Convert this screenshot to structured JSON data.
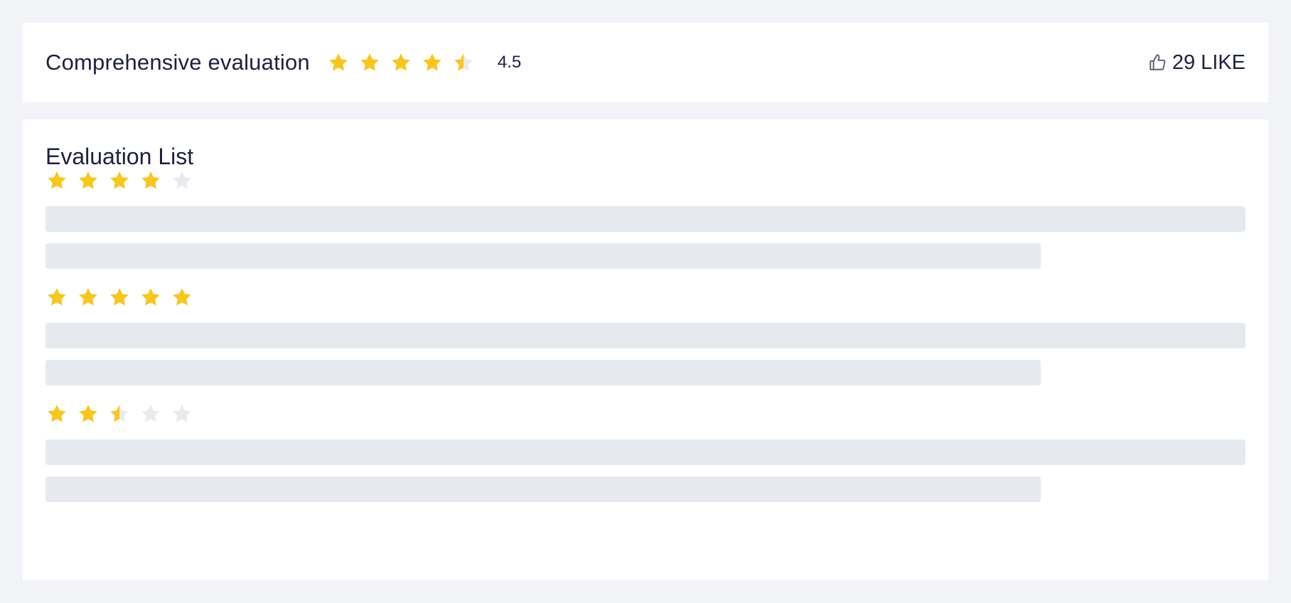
{
  "summary": {
    "title": "Comprehensive evaluation",
    "rating": 4.5,
    "max_rating": 5,
    "score_text": "4.5",
    "likes_text": "29 LIKE",
    "like_icon": "thumbs-up-icon"
  },
  "evaluation_list": {
    "title": "Evaluation List",
    "reviews": [
      {
        "rating": 4,
        "max_rating": 5
      },
      {
        "rating": 5,
        "max_rating": 5
      },
      {
        "rating": 2.5,
        "max_rating": 5
      }
    ]
  },
  "colors": {
    "background": "#f2f3f7",
    "card": "#ffffff",
    "star_filled": "#fbc61a",
    "star_empty": "#e8eaee",
    "skeleton": "#e6e9ee",
    "text": "#1d2140",
    "icon": "#5c6073"
  }
}
